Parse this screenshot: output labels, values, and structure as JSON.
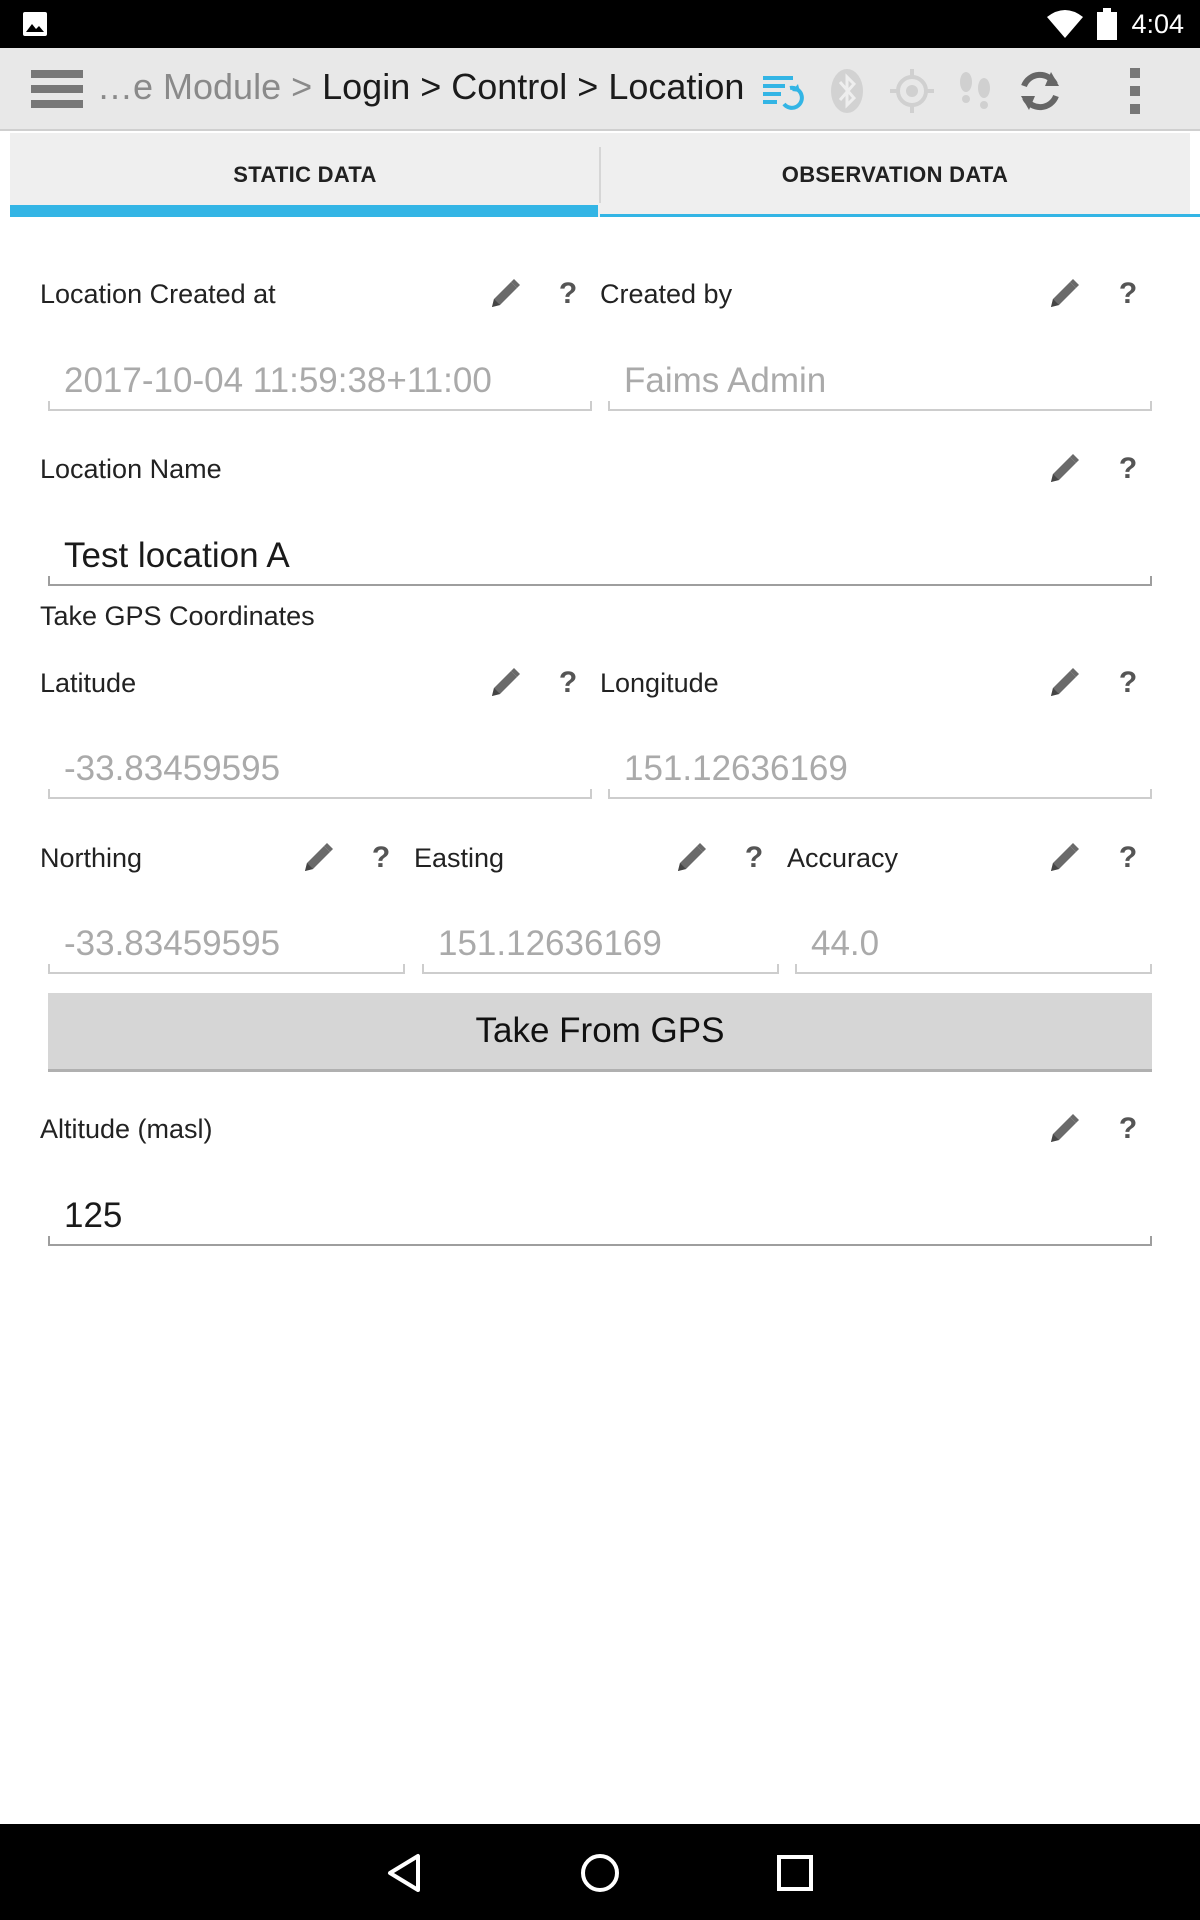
{
  "status_bar": {
    "time": "4:04"
  },
  "action_bar": {
    "breadcrumb_dim": "…e Module >",
    "breadcrumb_path": "Login > Control > Location",
    "accent_color": "#33b5e5"
  },
  "tabs": [
    {
      "label": "STATIC DATA",
      "selected": true
    },
    {
      "label": "OBSERVATION DATA",
      "selected": false
    }
  ],
  "form": {
    "created_at": {
      "label": "Location Created at",
      "value": "2017-10-04 11:59:38+11:00"
    },
    "created_by": {
      "label": "Created by",
      "value": "Faims Admin"
    },
    "location_name": {
      "label": "Location Name",
      "value": "Test location A"
    },
    "gps_section": {
      "label": "Take GPS Coordinates"
    },
    "latitude": {
      "label": "Latitude",
      "value": "-33.83459595"
    },
    "longitude": {
      "label": "Longitude",
      "value": "151.12636169"
    },
    "northing": {
      "label": "Northing",
      "value": "-33.83459595"
    },
    "easting": {
      "label": "Easting",
      "value": "151.12636169"
    },
    "accuracy": {
      "label": "Accuracy",
      "value": "44.0"
    },
    "take_gps_button": "Take From GPS",
    "altitude": {
      "label": "Altitude (masl)",
      "value": "125"
    },
    "help_glyph": "?"
  },
  "icons": [
    "menu-icon",
    "sync-status-icon",
    "bluetooth-icon",
    "gps-icon",
    "tracking-icon",
    "sync-icon",
    "overflow-menu-icon",
    "pencil-icon",
    "help-icon",
    "back-icon",
    "home-icon",
    "recents-icon"
  ]
}
